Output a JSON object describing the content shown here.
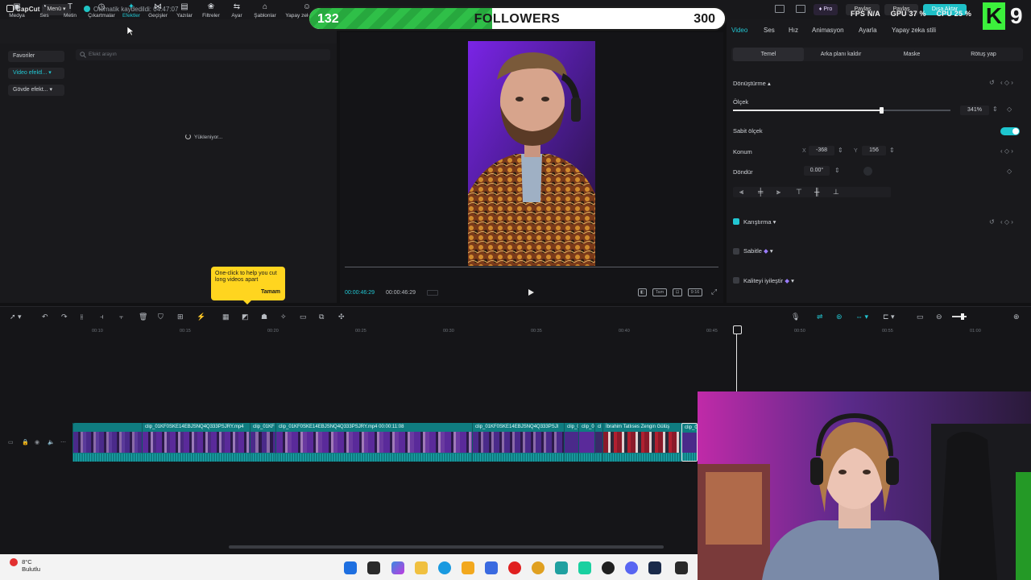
{
  "app": {
    "name": "CapCut",
    "menu_label": "Menü",
    "autosave": "Otomatik kaydedildi: 04:47:07",
    "pro_label": "Pro",
    "share1": "Paylaş",
    "share2": "Paylaş",
    "export_label": "Dışa Aktar"
  },
  "overlay": {
    "followers_current": "132",
    "followers_label": "FOLLOWERS",
    "followers_goal": "300",
    "followers_progress": 0.44,
    "fps_label": "FPS",
    "fps_value": "N/A",
    "gpu_label": "GPU",
    "gpu_value": "37 %",
    "cpu_label": "CPU",
    "cpu_value": "25 %",
    "k_logo": "K",
    "k_number": "9"
  },
  "toolbar": {
    "items": [
      "Medya",
      "Ses",
      "Metin",
      "Çıkartmalar",
      "Efektler",
      "Geçişler",
      "Yazılar",
      "Filtreler",
      "Ayar",
      "Şablonlar",
      "Yapay zekâ avatar"
    ],
    "active_index": 4
  },
  "left_panel": {
    "side": [
      "Favoriler",
      "Video efektl...",
      "Gövde efekt..."
    ],
    "search_placeholder": "Efekt arayın",
    "loading": "Yükleniyor...",
    "tooltip_text": "One-click to help you cut long videos apart",
    "tooltip_ok": "Tamam"
  },
  "preview": {
    "current_time": "00:00:46:29",
    "total_time": "00:00:46:29",
    "full_label": "Tam",
    "ratio_label": "9:16"
  },
  "right_panel": {
    "tabs": [
      "Video",
      "Ses",
      "Hız",
      "Animasyon",
      "Ayarla",
      "Yapay zeka stili"
    ],
    "active_tab": 0,
    "subtabs": [
      "Temel",
      "Arka planı kaldır",
      "Maske",
      "Rötuş yap"
    ],
    "transform": "Dönüştürme",
    "scale_label": "Ölçek",
    "scale_value": "341%",
    "scale_fraction": 0.68,
    "uniform_scale": "Sabit ölçek",
    "position_label": "Konum",
    "x_label": "X",
    "x_value": "-368",
    "y_label": "Y",
    "y_value": "156",
    "rotate_label": "Döndür",
    "rotate_value": "0.00°",
    "blend": "Karıştırma",
    "stabilize": "Sabitle",
    "enhance": "Kaliteyi iyileştir"
  },
  "timeline": {
    "ticks": [
      "00:10",
      "00:15",
      "00:20",
      "00:25",
      "00:30",
      "00:35",
      "00:40",
      "00:45",
      "00:50",
      "00:55",
      "01:00"
    ],
    "clips": [
      {
        "name": ""
      },
      {
        "name": "clip_01KF0SKE14EBJSNQ4Q333PSJRY.mp4"
      },
      {
        "name": "clip_01KF"
      },
      {
        "name": "clip_01KF0SKE14EBJSNQ4Q333PSJRY.mp4   00:00:11:08"
      },
      {
        "name": "clip_01KF0SKE14EBJSNQ4Q333PSJI"
      },
      {
        "name": "clip_0"
      },
      {
        "name": "clip_0"
      },
      {
        "name": "cl"
      },
      {
        "name": "İbrahim Tatlıses Zengin Gülüş"
      },
      {
        "name": "clip_0"
      }
    ]
  },
  "taskbar": {
    "temperature": "8°C",
    "weather": "Bulutlu"
  }
}
